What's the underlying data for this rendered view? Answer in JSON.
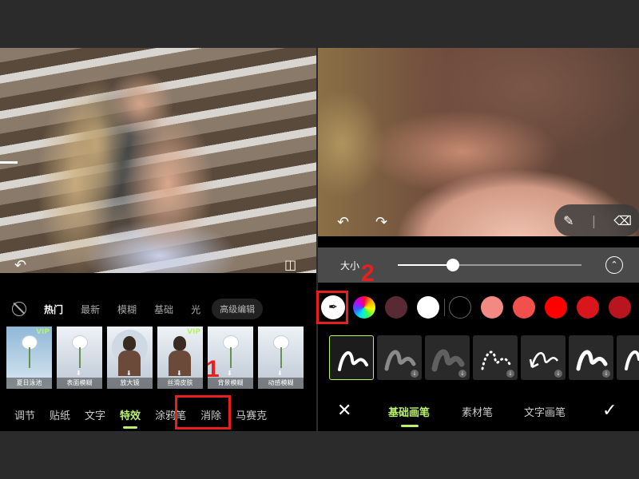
{
  "left_panel": {
    "undo_icon": "undo-icon",
    "compare_icon": "compare-icon",
    "categories": [
      "热门",
      "最新",
      "模糊",
      "基础",
      "光"
    ],
    "advanced_edit": "高级编辑",
    "effects": [
      {
        "label": "夏日泳池",
        "vip": "VIP"
      },
      {
        "label": "表面模糊",
        "vip": ""
      },
      {
        "label": "放大镜",
        "vip": ""
      },
      {
        "label": "丝滑皮肤",
        "vip": "VIP"
      },
      {
        "label": "背景模糊",
        "vip": ""
      },
      {
        "label": "动感模糊",
        "vip": ""
      }
    ],
    "nav": [
      "调节",
      "贴纸",
      "文字",
      "特效",
      "涂鸦笔",
      "消除",
      "马赛克"
    ],
    "active_nav": "特效"
  },
  "annotations": {
    "step1": "1",
    "step2": "2",
    "highlight_color": "#e81f1f"
  },
  "right_panel": {
    "size_label": "大小",
    "size_value": 0.3,
    "colors": [
      "#5a2a34",
      "#ffffff",
      "#000000",
      "#f28a83",
      "#f1504d",
      "#ff0000",
      "#d9161c",
      "#b8151f",
      "#f4a07a"
    ],
    "tabs": [
      "基础画笔",
      "素材笔",
      "文字画笔"
    ],
    "active_tab": "基础画笔",
    "accent_color": "#b9f26a"
  }
}
